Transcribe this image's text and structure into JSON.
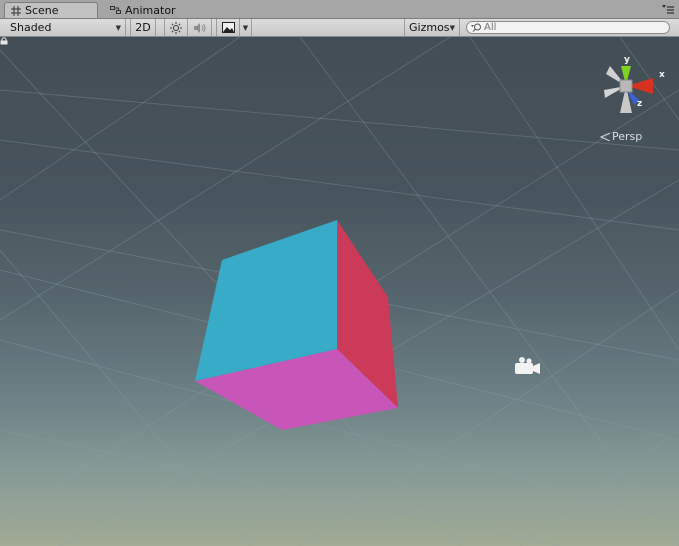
{
  "tabs": [
    {
      "label": "Scene",
      "icon": "grid-icon",
      "active": true
    },
    {
      "label": "Animator",
      "icon": "animator-icon",
      "active": false
    }
  ],
  "toolbar": {
    "shading_mode": "Shaded",
    "mode_2d_label": "2D",
    "lighting_icon": "sun-icon",
    "audio_icon": "speaker-icon",
    "effects_icon": "image-icon",
    "gizmos_label": "Gizmos"
  },
  "search": {
    "placeholder": "All"
  },
  "scene": {
    "projection_label": "Persp",
    "gizmo_axes": [
      "y",
      "x",
      "z"
    ],
    "axis_colors": {
      "x": "#d6321f",
      "y": "#7ed221",
      "z": "#3a63d8"
    },
    "cube_colors": {
      "front": "#37abc8",
      "right": "#cc3a5a",
      "bottom": "#c855b8"
    },
    "camera_icon": "camera-icon"
  }
}
